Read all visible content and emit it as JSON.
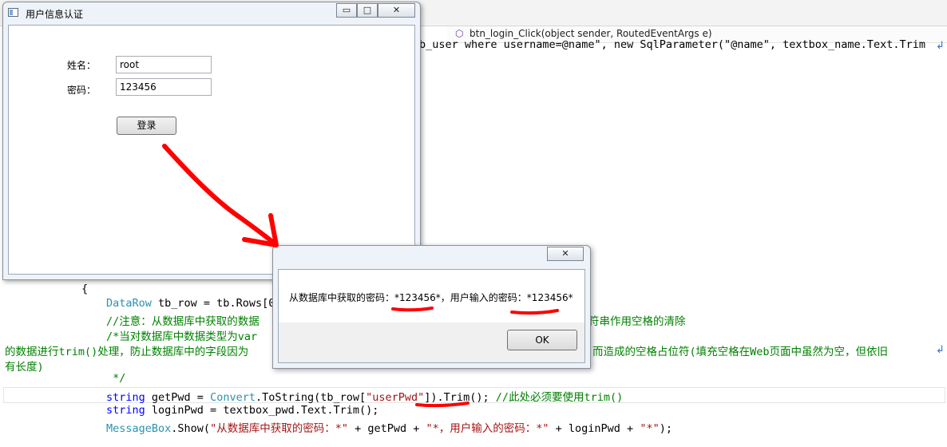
{
  "ide": {
    "nav_method": "btn_login_Click(object sender, RoutedEventArgs e)",
    "nav_icon": "method-icon",
    "code": {
      "line_sql": "b_user where username=@name\", new SqlParameter(\"@name\", textbox_name.Text.Trim",
      "line_brace": "{",
      "line_datarow_type": "DataRow",
      "line_datarow_rest": " tb_row = tb.Rows[0]",
      "line_comment1_end": "符串作用空格的清除",
      "line_comment1_start": "//注意：从数据库中获取的数据",
      "line_comment2_start": "/*当对数据库中数据类型为var",
      "line_wrap1_start": "的数据进行trim()处理，防止数据库中的字段因为",
      "line_wrap1_end": "而造成的空格占位符(填充空格在Web页面中虽然为空，但依旧",
      "line_wrap2": "有长度)",
      "line_comment_close": " */",
      "line_getpwd": {
        "kw": "string",
        "a": " getPwd = ",
        "ty": "Convert",
        "b": ".ToString(tb_row[",
        "str": "\"userPwd\"",
        "c": "]).Trim(); ",
        "cm": "//此处必须要使用trim()"
      },
      "line_loginpwd": {
        "kw": "string",
        "a": " loginPwd = textbox_pwd.Text.Trim();"
      },
      "line_msgbox": {
        "ty": "MessageBox",
        "a": ".Show(",
        "s1": "\"从数据库中获取的密码：*\"",
        "b": " + getPwd + ",
        "s2": "\"*，用户输入的密码：*\"",
        "c": " + loginPwd + ",
        "s3": "\"*\"",
        "d": ");"
      }
    }
  },
  "login_window": {
    "title": "用户信息认证",
    "name_label": "姓名：",
    "name_value": "root",
    "pwd_label": "密码：",
    "pwd_value": "123456",
    "login_button": "登录",
    "minimize": "▭",
    "maximize": "□",
    "close": "✕"
  },
  "message_box": {
    "text": "从数据库中获取的密码：*123456*，用户输入的密码：*123456*",
    "ok_button": "OK",
    "close": "✕"
  },
  "colors": {
    "annotation": "#ff0000",
    "keyword": "#0000ff",
    "type": "#2b91af",
    "string": "#a31515",
    "comment": "#008000"
  }
}
